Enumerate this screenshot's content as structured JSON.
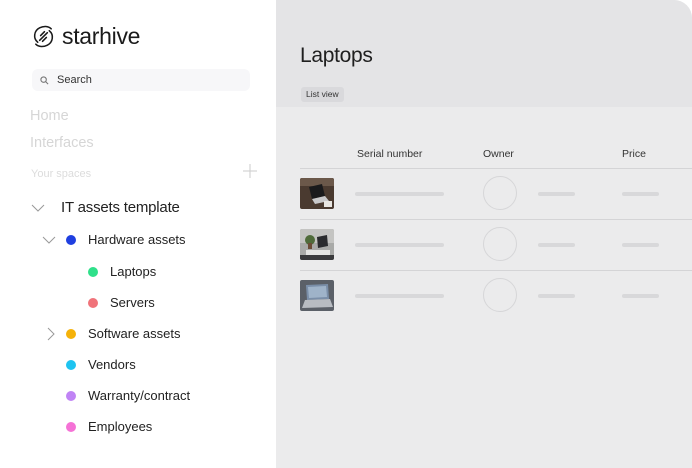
{
  "brand": {
    "name": "starhive"
  },
  "search": {
    "placeholder": "Search"
  },
  "nav": {
    "home": "Home",
    "interfaces": "Interfaces"
  },
  "spaces": {
    "header": "Your spaces",
    "template": "IT assets template",
    "items": [
      {
        "label": "Hardware assets",
        "color": "#1f3fe0"
      },
      {
        "label": "Laptops",
        "color": "#2fe08a"
      },
      {
        "label": "Servers",
        "color": "#f0737a"
      },
      {
        "label": "Software assets",
        "color": "#f5b20a"
      },
      {
        "label": "Vendors",
        "color": "#1ec3f0"
      },
      {
        "label": "Warranty/contract",
        "color": "#c084f5"
      },
      {
        "label": "Employees",
        "color": "#f572d6"
      }
    ]
  },
  "main": {
    "title": "Laptops",
    "view_label": "List view",
    "columns": {
      "serial": "Serial number",
      "owner": "Owner",
      "price": "Price"
    },
    "rows": [
      {
        "thumb": "laptop-on-desk-photo"
      },
      {
        "thumb": "laptop-with-plant-photo"
      },
      {
        "thumb": "laptop-open-photo"
      }
    ]
  }
}
